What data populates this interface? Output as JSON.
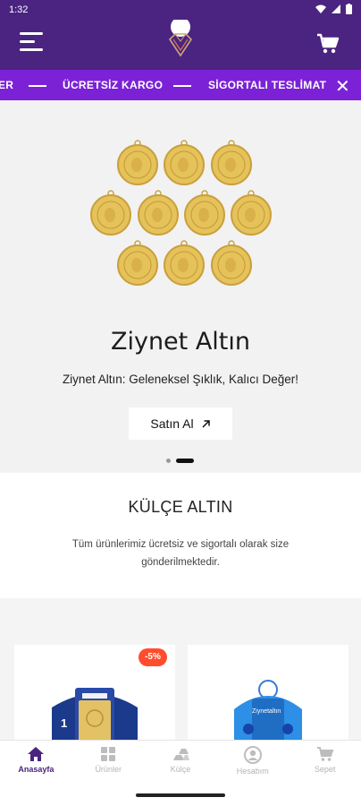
{
  "status_bar": {
    "time": "1:32",
    "icons": [
      "wifi-icon",
      "signal-icon",
      "battery-icon"
    ]
  },
  "header": {
    "logo": "brand-logo",
    "menu_icon": "menu-icon",
    "cart_icon": "cart-icon",
    "bg_color": "#4a2480"
  },
  "ticker": {
    "items": [
      "ER",
      "ÜCRETSİZ KARGO",
      "SİGORTALI TESLİMAT"
    ],
    "close_icon": "close-icon",
    "bg_color": "#7b22d6"
  },
  "hero": {
    "title": "Ziynet Altın",
    "subtitle": "Ziynet Altın: Geleneksel Şıklık, Kalıcı Değer!",
    "button_label": "Satın Al",
    "button_icon": "arrow-up-right-icon",
    "slides": 2,
    "active_slide": 2
  },
  "section": {
    "title": "KÜLÇE ALTIN",
    "description": "Tüm ürünlerimiz ücretsiz ve sigortalı olarak size gönderilmektedir."
  },
  "products": {
    "discount_badge": "-5%",
    "card_left_label": "1",
    "card_right_label": "Ziynetaltın"
  },
  "bottom_nav": {
    "items": [
      {
        "label": "Anasayfa",
        "icon": "home-icon",
        "active": true
      },
      {
        "label": "Ürünler",
        "icon": "grid-icon",
        "active": false
      },
      {
        "label": "Külçe",
        "icon": "gold-bars-icon",
        "active": false
      },
      {
        "label": "Hesabım",
        "icon": "account-icon",
        "active": false
      },
      {
        "label": "Sepet",
        "icon": "cart-icon",
        "active": false
      }
    ]
  }
}
